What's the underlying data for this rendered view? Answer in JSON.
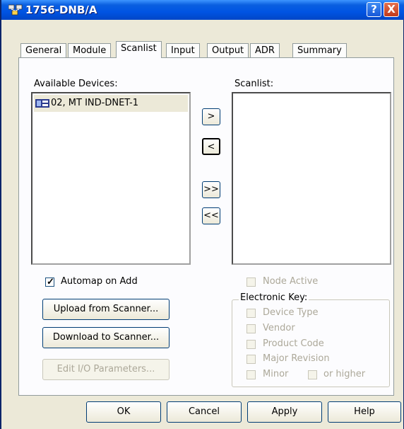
{
  "window": {
    "title": "1756-DNB/A",
    "help_label": "?",
    "close_label": "X"
  },
  "tabs": [
    "General",
    "Module",
    "Scanlist",
    "Input",
    "Output",
    "ADR",
    "Summary"
  ],
  "available_devices": {
    "label": "Available Devices:",
    "items": [
      {
        "label": "02, MT IND-DNET-1"
      }
    ]
  },
  "scanlist": {
    "label": "Scanlist:"
  },
  "move_buttons": {
    "add": ">",
    "remove": "<",
    "add_all": ">>",
    "remove_all": "<<"
  },
  "automap": {
    "label": "Automap on Add",
    "checked": true
  },
  "buttons": {
    "upload": "Upload from Scanner...",
    "download": "Download to Scanner...",
    "edit_io": "Edit I/O Parameters..."
  },
  "node_active": {
    "label": "Node Active",
    "checked": false
  },
  "electronic_key": {
    "title": "Electronic Key:",
    "device_type": "Device Type",
    "vendor": "Vendor",
    "product_code": "Product Code",
    "major_revision": "Major Revision",
    "minor": "Minor",
    "or_higher": "or higher"
  },
  "footer": {
    "ok": "OK",
    "cancel": "Cancel",
    "apply": "Apply",
    "help": "Help"
  },
  "colors": {
    "titlebar": "#0054e3",
    "dialog_bg": "#ece9d8",
    "panel_bg": "#fcfcfe",
    "disabled_text": "#aca899"
  }
}
